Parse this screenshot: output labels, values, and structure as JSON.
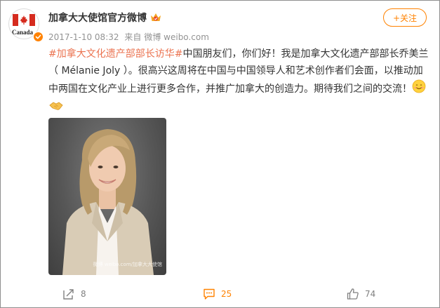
{
  "user": {
    "name": "加拿大大使馆官方微博",
    "avatar_text": "Canada",
    "verified": true
  },
  "meta": {
    "time": "2017-1-10 08:32",
    "source_prefix": "来自",
    "source": "微博 weibo.com"
  },
  "follow_label": "+关注",
  "post": {
    "topic": "#加拿大文化遗产部部长访华#",
    "body": "中国朋友们，你们好！我是加拿大文化遗产部部长乔美兰（ Mélanie Joly ）。很高兴这周将在中国与中国领导人和艺术创作者们会面，以推动加中两国在文化产业上进行更多合作，并推广加拿大的创造力。期待我们之间的交流！",
    "emojis": [
      "smile-emoji",
      "handshake-emoji"
    ]
  },
  "photo": {
    "watermark": "微博 weibo.com/加拿大大使馆"
  },
  "actions": {
    "repost_count": "8",
    "comment_count": "25",
    "like_count": "74"
  },
  "colors": {
    "accent": "#ff8200",
    "topic": "#eb7350",
    "meta": "#939393",
    "canada_red": "#d52b1e"
  }
}
